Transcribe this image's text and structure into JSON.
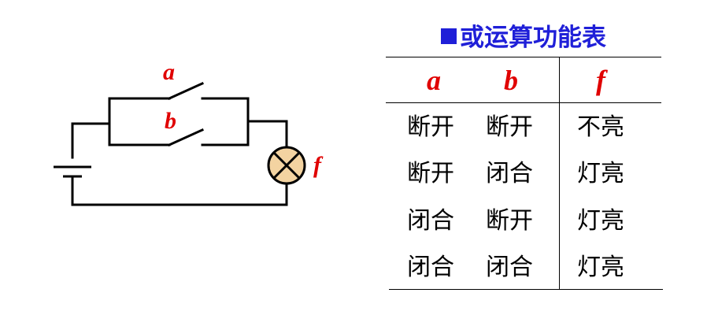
{
  "circuit": {
    "label_a": "a",
    "label_b": "b",
    "label_f": "f"
  },
  "table": {
    "title": "或运算功能表",
    "title_marker": "square-bullet",
    "headers": [
      "a",
      "b",
      "f"
    ],
    "rows": [
      [
        "断开",
        "断开",
        "不亮"
      ],
      [
        "断开",
        "闭合",
        "灯亮"
      ],
      [
        "闭合",
        "断开",
        "灯亮"
      ],
      [
        "闭合",
        "闭合",
        "灯亮"
      ]
    ]
  },
  "colors": {
    "title": "#1f1fd8",
    "label": "#e00000",
    "lamp_fill": "#f3d3a1",
    "wire": "#000000"
  }
}
